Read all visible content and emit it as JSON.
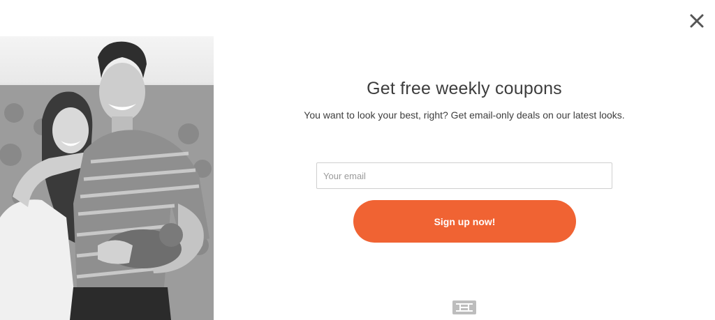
{
  "popup": {
    "title": "Get free weekly coupons",
    "subtitle": "You want to look your best, right? Get email-only deals on our latest looks.",
    "email_placeholder": "Your email",
    "email_value": "",
    "submit_label": "Sign up now!",
    "close_icon": "close-icon",
    "logo_icon": "brand-logo-icon",
    "photo": "black-and-white photo of a smiling couple holding a kitten",
    "colors": {
      "accent": "#f06333",
      "text": "#3d3d3d",
      "background": "#ffffff"
    }
  }
}
